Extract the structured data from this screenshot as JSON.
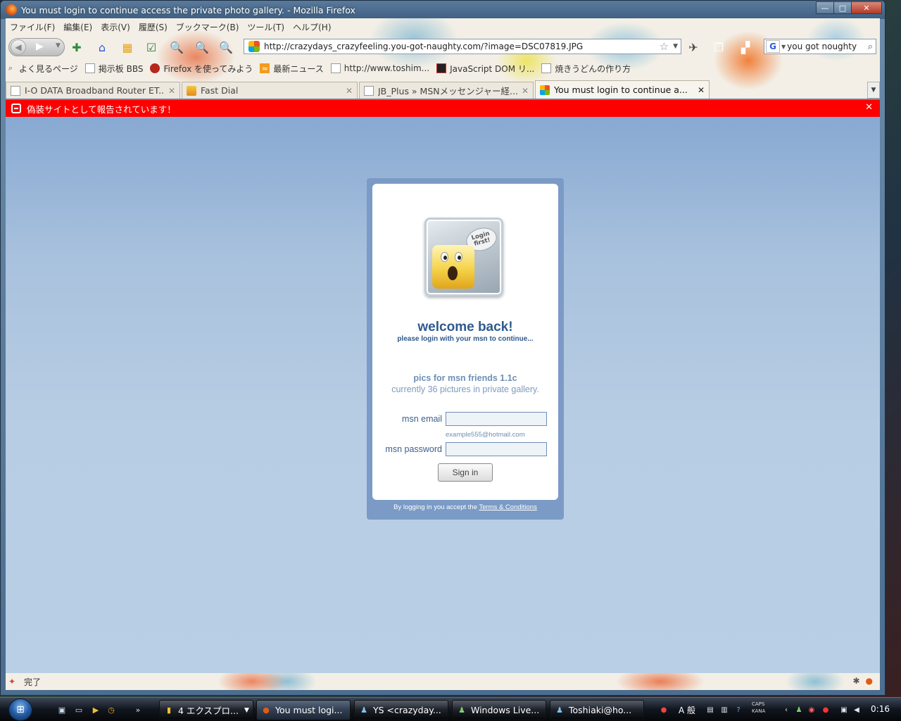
{
  "window": {
    "title": "You must login to continue access the private photo gallery. - Mozilla Firefox",
    "controls": {
      "minimize": "—",
      "maximize": "□",
      "close": "✕"
    }
  },
  "menu": [
    "ファイル(F)",
    "編集(E)",
    "表示(V)",
    "履歴(S)",
    "ブックマーク(B)",
    "ツール(T)",
    "ヘルプ(H)"
  ],
  "navbar": {
    "url": "http://crazydays_crazyfeeling.you-got-naughty.com/?image=DSC07819.JPG",
    "search_query": "you got noughty",
    "search_engine_letter": "G"
  },
  "bookmarks": [
    {
      "icon": "magnifier-icon",
      "label": "よく見るページ"
    },
    {
      "icon": "page-icon",
      "label": "掲示板 BBS"
    },
    {
      "icon": "firefox-icon",
      "label": "Firefox を使ってみよう"
    },
    {
      "icon": "rss-icon",
      "label": "最新ニュース"
    },
    {
      "icon": "page-icon",
      "label": "http://www.toshim..."
    },
    {
      "icon": "js-icon",
      "label": "JavaScript DOM リ..."
    },
    {
      "icon": "page-icon",
      "label": "焼きうどんの作り方"
    }
  ],
  "tabs": [
    {
      "label": "I-O DATA Broadband Router ET...",
      "icon": "page-icon",
      "active": false
    },
    {
      "label": "Fast Dial",
      "icon": "dial-icon",
      "active": false
    },
    {
      "label": "JB_Plus » MSNメッセンジャー経...",
      "icon": "page-icon",
      "active": false
    },
    {
      "label": "You must login to continue a...",
      "icon": "msn-icon",
      "active": true
    }
  ],
  "warning": {
    "text": "偽装サイトとして報告されています！",
    "color": "#ff0000"
  },
  "login": {
    "bubble_text": "Login first!",
    "welcome": "welcome back!",
    "subtitle": "please login with your msn to continue...",
    "pics_title": "pics for msn friends 1.1c",
    "pics_count": "currently 36 pictures in private gallery.",
    "email_label": "msn email",
    "email_value": "",
    "email_hint": "example555@hotmail.com",
    "password_label": "msn password",
    "password_value": "",
    "signin_label": "Sign in",
    "terms_prefix": "By logging in you accept the ",
    "terms_link": "Terms & Conditions"
  },
  "status": {
    "text": "完了"
  },
  "taskbar": {
    "start_glyph": "⊞",
    "quicklaunch_more": "»",
    "buttons": [
      {
        "label": "4 エクスプロ...",
        "icon": "folder-icon",
        "active": false
      },
      {
        "label": "You must logi...",
        "icon": "firefox-icon",
        "active": true
      },
      {
        "label": "YS <crazyday...",
        "icon": "msn-icon",
        "active": false
      },
      {
        "label": "Windows Live...",
        "icon": "messenger-icon",
        "active": false
      },
      {
        "label": "Toshiaki@ho...",
        "icon": "msn-icon",
        "active": false
      }
    ],
    "ime": "A 般",
    "caps": "CAPS",
    "kana": "KANA",
    "clock": "0:16"
  },
  "colors": {
    "accent": "#2f5a8c",
    "panel_frame": "#7b9bc6",
    "warning_bg": "#ff0000"
  }
}
